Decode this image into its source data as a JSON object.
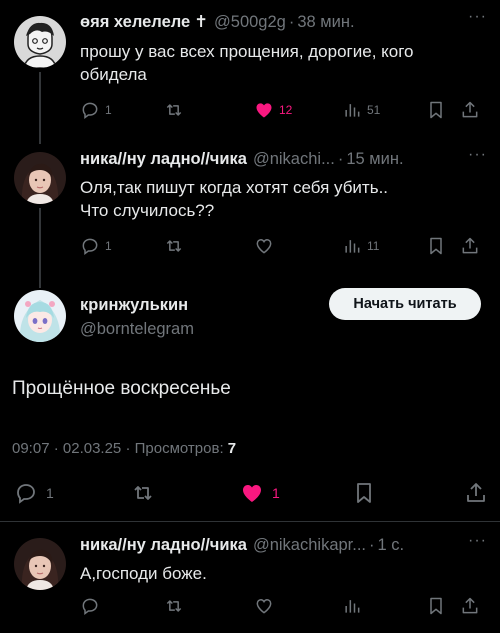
{
  "post1": {
    "name": "өяя хелелеле",
    "cross": "✝",
    "handle": "@500g2g",
    "time": "38 мин.",
    "text_line1": "прошу у вас всех прощения, дорогие, кого",
    "text_line2": "обидела",
    "replies": "1",
    "retweets": "",
    "likes": "12",
    "views": "51",
    "liked": true
  },
  "post2": {
    "name": "ника//ну ладно//чика",
    "handle": "@nikachi...",
    "time": "15 мин.",
    "text_line1": "Оля,так пишут когда хотят себя убить..",
    "text_line2": "Что случилось??",
    "replies": "1",
    "retweets": "",
    "likes": "",
    "views": "11"
  },
  "main": {
    "name": "кринжулькин",
    "handle": "@borntelegram",
    "follow_label": "Начать читать",
    "text": "Прощённое воскресенье",
    "time": "09:07",
    "date": "02.03.25",
    "views_label": "Просмотров:",
    "views": "7",
    "replies": "1",
    "likes": "1",
    "liked": true
  },
  "reply": {
    "name": "ника//ну ладно//чика",
    "handle": "@nikachikapr...",
    "time": "1 с.",
    "text": "А,господи боже."
  },
  "colors": {
    "like_pink": "#f91880",
    "muted": "#71767b",
    "text": "#e7e9ea",
    "bg": "#000000"
  }
}
